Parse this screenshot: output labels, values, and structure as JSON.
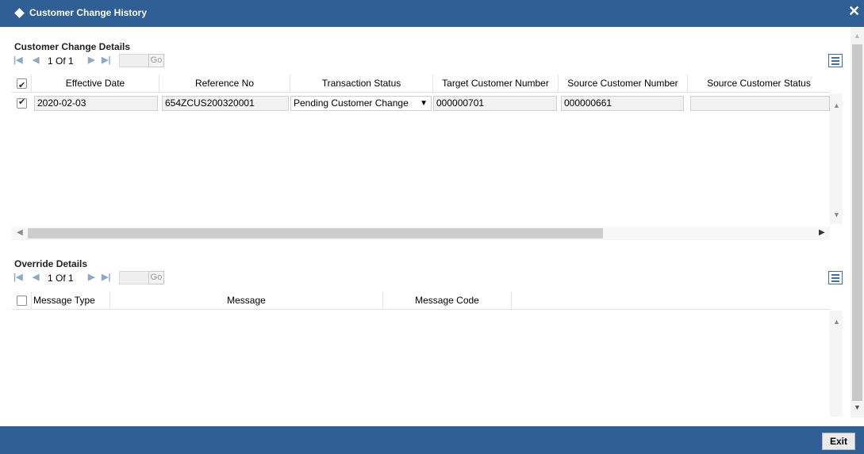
{
  "window": {
    "title": "Customer Change History",
    "close_symbol": "✕"
  },
  "customer_change": {
    "section_title": "Customer Change Details",
    "pager": {
      "page_info": "1 Of 1",
      "go_label": "Go"
    },
    "columns": [
      "Effective Date",
      "Reference No",
      "Transaction Status",
      "Target Customer Number",
      "Source Customer Number",
      "Source Customer Status"
    ],
    "rows": [
      {
        "checked": true,
        "effective_date": "2020-02-03",
        "reference_no": "654ZCUS200320001",
        "transaction_status": "Pending Customer Change",
        "target_customer_number": "000000701",
        "source_customer_number": "000000661",
        "source_customer_status": ""
      }
    ]
  },
  "override": {
    "section_title": "Override Details",
    "pager": {
      "page_info": "1 Of 1",
      "go_label": "Go"
    },
    "columns": [
      "Message Type",
      "Message",
      "Message Code"
    ]
  },
  "footer": {
    "exit_label": "Exit"
  },
  "icons": {
    "first_page": "first-page-icon",
    "prev_page": "prev-page-icon",
    "next_page": "next-page-icon",
    "last_page": "last-page-icon",
    "columns": "columns-list-icon"
  },
  "colors": {
    "titlebar": "#2f5f94",
    "footer": "#2f5f94"
  }
}
